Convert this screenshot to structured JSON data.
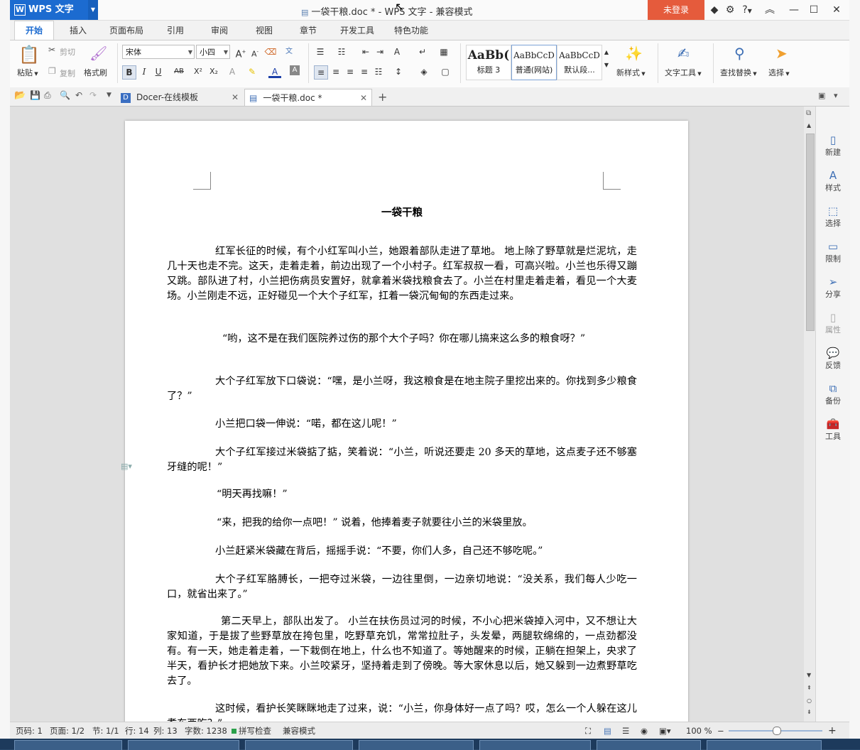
{
  "titlebar": {
    "app_name": "WPS 文字",
    "doc_title": "一袋干粮.doc * - WPS 文字 - 兼容模式",
    "login_label": "未登录",
    "help_label": "?"
  },
  "menu": {
    "tabs": [
      "开始",
      "插入",
      "页面布局",
      "引用",
      "审阅",
      "视图",
      "章节",
      "开发工具",
      "特色功能"
    ]
  },
  "ribbon": {
    "paste": "粘贴",
    "cut": "剪切",
    "copy": "复制",
    "format_painter": "格式刷",
    "font_name": "宋体",
    "font_size": "小四",
    "styles": [
      {
        "preview": "AaBb(",
        "name": "标题 3"
      },
      {
        "preview": "AaBbCcD",
        "name": "普通(网站)"
      },
      {
        "preview": "AaBbCcD",
        "name": "默认段..."
      }
    ],
    "new_style": "新样式",
    "text_tools": "文字工具",
    "find_replace": "查找替换",
    "select": "选择"
  },
  "doctabs": [
    {
      "label": "Docer-在线模板"
    },
    {
      "label": "一袋干粮.doc *"
    }
  ],
  "document": {
    "title": "一袋干粮",
    "paragraphs": [
      "红军长征的时候，有个小红军叫小兰，她跟着部队走进了草地。 地上除了野草就是烂泥坑，走几十天也走不完。这天，走着走着，前边出现了一个小村子。红军叔叔一看，可高兴啦。小兰也乐得又蹦又跳。部队进了村，小兰把伤病员安置好，就拿着米袋找粮食去了。小兰在村里走着走着，看见一个大麦场。小兰刚走不远，正好碰见一个大个子红军，扛着一袋沉甸甸的东西走过来。",
      "“哟，这不是在我们医院养过伤的那个大个子吗？你在哪儿搞来这么多的粮食呀？”",
      "大个子红军放下口袋说：“嘿，是小兰呀，我这粮食是在地主院子里挖出来的。你找到多少粮食了？”",
      "小兰把口袋一伸说：“喏，都在这儿呢！”",
      "大个子红军接过米袋掂了掂，笑着说：“小兰，听说还要走 20 多天的草地，这点麦子还不够塞牙缝的呢！”",
      "“明天再找嘛！”",
      "“来，把我的给你一点吧！” 说着，他捧着麦子就要往小兰的米袋里放。",
      "小兰赶紧米袋藏在背后，摇摇手说：“不要，你们人多，自己还不够吃呢。”",
      "大个子红军胳膊长，一把夺过米袋，一边往里倒，一边亲切地说：“没关系，我们每人少吃一口，就省出来了。”",
      "第二天早上，部队出发了。 小兰在扶伤员过河的时候，不小心把米袋掉入河中，又不想让大家知道，于是拔了些野草放在挎包里，吃野草充饥，常常拉肚子，头发晕，两腿软绵绵的，一点劲都没有。有一天，她走着走着，一下栽倒在地上，什么也不知道了。等她醒来的时候，正躺在担架上，央求了半天，看护长才把她放下来。小兰咬紧牙，坚持着走到了傍晚。等大家休息以后，她又躲到一边煮野草吃去了。",
      "这时候，看护长笑眯眯地走了过来，说：“小兰，你身体好一点了吗？哎，怎么一个人躲在这儿煮东西吃？”"
    ]
  },
  "rightpanel": [
    "新建",
    "样式",
    "选择",
    "限制",
    "分享",
    "属性",
    "反馈",
    "备份",
    "工具"
  ],
  "statusbar": {
    "page_no": "页码: 1",
    "pages": "页面: 1/2",
    "section": "节: 1/1",
    "row": "行: 14",
    "col": "列: 13",
    "wordcount": "字数: 1238",
    "spellcheck": "拼写检查",
    "compat": "兼容模式",
    "zoom": "100 %"
  },
  "colors": {
    "brand": "#1c6bd0",
    "login": "#e55b3c"
  }
}
